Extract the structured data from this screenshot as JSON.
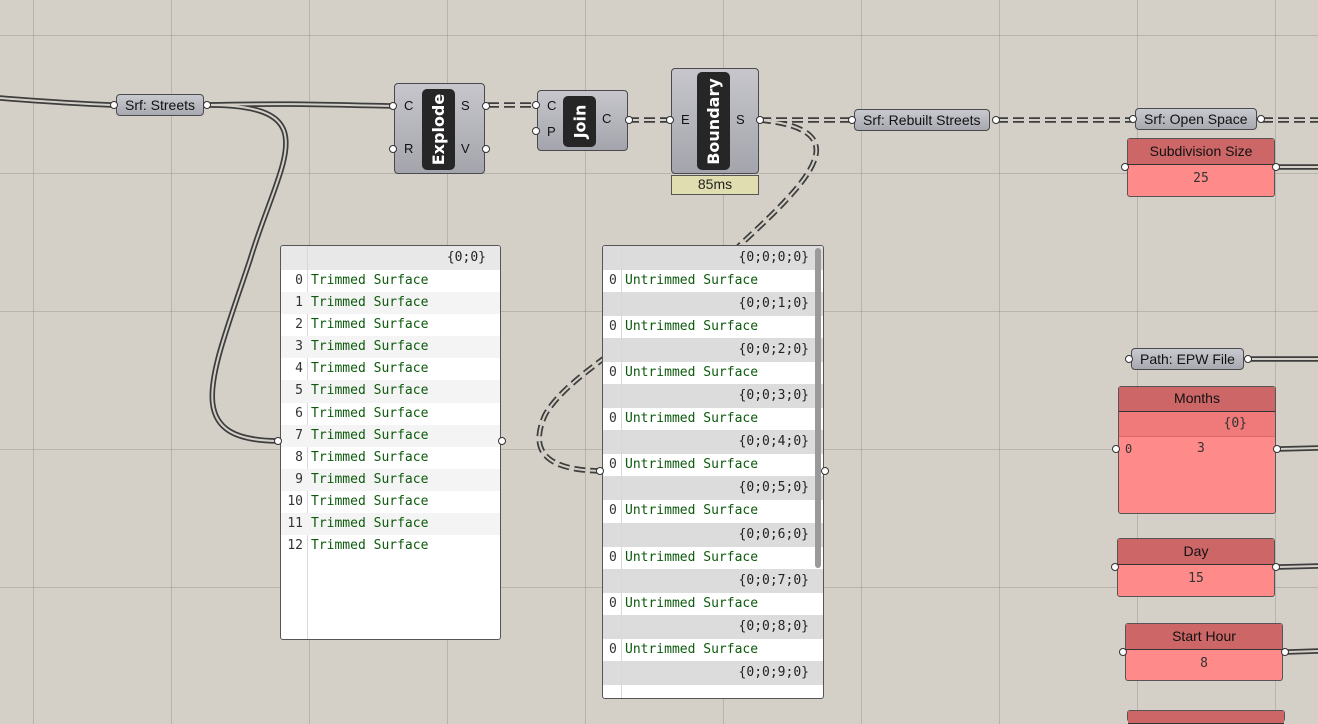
{
  "params": {
    "streets": "Srf: Streets",
    "rebuilt": "Srf: Rebuilt Streets",
    "open_space": "Srf: Open Space",
    "epw": "Path: EPW File"
  },
  "explode": {
    "name": "Explode",
    "in": [
      "C",
      "R"
    ],
    "out": [
      "S",
      "V"
    ]
  },
  "join": {
    "name": "Join",
    "in": [
      "C",
      "P"
    ],
    "out": [
      "C"
    ]
  },
  "boundary": {
    "name": "Boundary",
    "in": [
      "E"
    ],
    "out": [
      "S"
    ],
    "timer": "85ms"
  },
  "sliders": {
    "subdivision": {
      "label": "Subdivision Size",
      "value": "25"
    },
    "months": {
      "label": "Months",
      "path": "{0}",
      "index": "0",
      "value": "3"
    },
    "day": {
      "label": "Day",
      "value": "15"
    },
    "start_hour": {
      "label": "Start Hour",
      "value": "8"
    }
  },
  "panel1": {
    "header": "{0;0}",
    "rows": [
      "Trimmed Surface",
      "Trimmed Surface",
      "Trimmed Surface",
      "Trimmed Surface",
      "Trimmed Surface",
      "Trimmed Surface",
      "Trimmed Surface",
      "Trimmed Surface",
      "Trimmed Surface",
      "Trimmed Surface",
      "Trimmed Surface",
      "Trimmed Surface",
      "Trimmed Surface"
    ]
  },
  "panel2": {
    "branches": [
      {
        "path": "{0;0;0;0}",
        "index": "0",
        "value": "Untrimmed Surface"
      },
      {
        "path": "{0;0;1;0}",
        "index": "0",
        "value": "Untrimmed Surface"
      },
      {
        "path": "{0;0;2;0}",
        "index": "0",
        "value": "Untrimmed Surface"
      },
      {
        "path": "{0;0;3;0}",
        "index": "0",
        "value": "Untrimmed Surface"
      },
      {
        "path": "{0;0;4;0}",
        "index": "0",
        "value": "Untrimmed Surface"
      },
      {
        "path": "{0;0;5;0}",
        "index": "0",
        "value": "Untrimmed Surface"
      },
      {
        "path": "{0;0;6;0}",
        "index": "0",
        "value": "Untrimmed Surface"
      },
      {
        "path": "{0;0;7;0}",
        "index": "0",
        "value": "Untrimmed Surface"
      },
      {
        "path": "{0;0;8;0}",
        "index": "0",
        "value": "Untrimmed Surface"
      },
      {
        "path": "{0;0;9;0}"
      }
    ]
  }
}
